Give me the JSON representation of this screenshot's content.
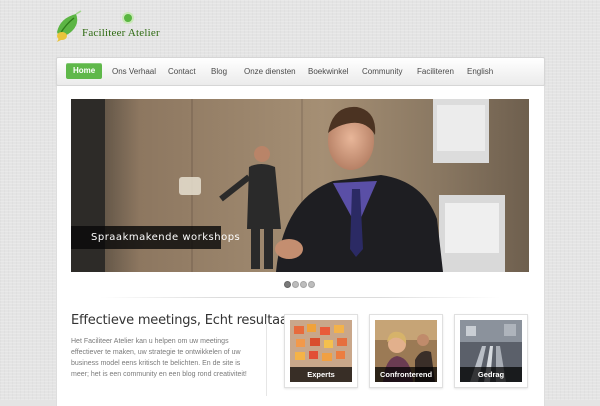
{
  "logo": {
    "text": "Faciliteer Atelier",
    "icon": "leaf-speech-bubble-icon"
  },
  "nav": {
    "items": [
      {
        "label": "Home",
        "active": true
      },
      {
        "label": "Ons Verhaal"
      },
      {
        "label": "Contact"
      },
      {
        "label": "Blog"
      },
      {
        "label": "Onze diensten"
      },
      {
        "label": "Boekwinkel"
      },
      {
        "label": "Community"
      },
      {
        "label": "Faciliteren"
      },
      {
        "label": "English"
      }
    ]
  },
  "slider": {
    "caption": "Spraakmakende workshops",
    "slide_count": 4,
    "active_slide": 1
  },
  "intro": {
    "title": "Effectieve meetings, Echt resultaat",
    "body": "Het Faciliteer Atelier kan u helpen om uw meetings effectiever te maken, uw strategie te ontwikkelen of uw business model eens kritisch te belichten. En de site is meer; het is een community en een blog rond creativiteit!"
  },
  "tiles": [
    {
      "label": "Experts"
    },
    {
      "label": "Confronterend"
    },
    {
      "label": "Gedrag"
    }
  ],
  "colors": {
    "accent": "#5fb84a",
    "background": "#e4e4e4",
    "caption_bg": "#0a0a0a",
    "text": "#333333"
  }
}
